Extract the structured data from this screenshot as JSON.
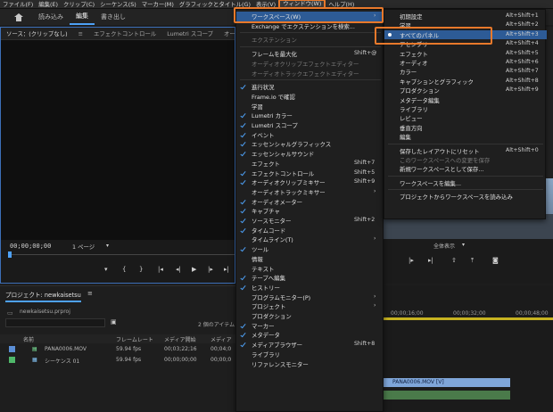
{
  "menubar": [
    "ファイル(F)",
    "編集(E)",
    "クリップ(C)",
    "シーケンス(S)",
    "マーカー(M)",
    "グラフィックとタイトル(G)",
    "表示(V)",
    "ウィンドウ(W)",
    "ヘルプ(H)"
  ],
  "workspace_tabs": [
    "読み込み",
    "編集",
    "書き出し"
  ],
  "source_tabs": [
    "ソース：(クリップなし)",
    "エフェクトコントロール",
    "Lumetri スコープ",
    "オーディ"
  ],
  "source_panel": {
    "timecode": "00;00;00;00",
    "page": "1 ページ"
  },
  "project": {
    "tab": "プロジェクト: newkaisetsu",
    "file": "newkaisetsu.prproj",
    "count": "2 個のアイテム",
    "headers": [
      "名前",
      "フレームレート",
      "メディア開始",
      "メディア"
    ],
    "rows": [
      {
        "name": "PANA0006.MOV",
        "fps": "59.94 fps",
        "start": "00;03;22;16",
        "end": "00;04;0"
      },
      {
        "name": "シーケンス 01",
        "fps": "59.94 fps",
        "start": "00;00;00;00",
        "end": "00;00;0"
      }
    ]
  },
  "right_panel": {
    "timecode": "00;00;00;00",
    "display": "全体表示",
    "ruler": [
      "00;00;16;00",
      "00;00;32;00",
      "00;00;48;00"
    ],
    "clip": "PANA0006.MOV [V]"
  },
  "window_menu": {
    "items": [
      {
        "label": "ワークスペース(W)",
        "submenu": true,
        "hl": true
      },
      {
        "label": "Exchange でエクステンションを検索..."
      },
      {
        "sep": true
      },
      {
        "label": "エクステンション",
        "dis": true
      },
      {
        "sep": true
      },
      {
        "label": "フレームを最大化",
        "sc": "Shift+@"
      },
      {
        "label": "オーディオクリップエフェクトエディター",
        "dis": true
      },
      {
        "label": "オーディオトラックエフェクトエディター",
        "dis": true
      },
      {
        "sep": true
      },
      {
        "label": "進行状況",
        "ck": true
      },
      {
        "label": "Frame.io で確認"
      },
      {
        "label": "学習"
      },
      {
        "label": "Lumetri カラー",
        "ck": true
      },
      {
        "label": "Lumetri スコープ",
        "ck": true
      },
      {
        "label": "イベント",
        "ck": true
      },
      {
        "label": "エッセンシャルグラフィックス",
        "ck": true
      },
      {
        "label": "エッセンシャルサウンド",
        "ck": true
      },
      {
        "label": "エフェクト",
        "sc": "Shift+7"
      },
      {
        "label": "エフェクトコントロール",
        "sc": "Shift+5",
        "ck": true
      },
      {
        "label": "オーディオクリップミキサー",
        "sc": "Shift+9",
        "ck": true
      },
      {
        "label": "オーディオトラックミキサー",
        "submenu": true
      },
      {
        "label": "オーディオメーター",
        "ck": true
      },
      {
        "label": "キャプチャ",
        "ck": true
      },
      {
        "label": "ソースモニター",
        "sc": "Shift+2",
        "ck": true
      },
      {
        "label": "タイムコード",
        "ck": true
      },
      {
        "label": "タイムライン(T)",
        "submenu": true
      },
      {
        "label": "ツール",
        "ck": true
      },
      {
        "label": "情報"
      },
      {
        "label": "テキスト"
      },
      {
        "label": "テープへ編集",
        "ck": true
      },
      {
        "label": "ヒストリー",
        "ck": true
      },
      {
        "label": "プログラムモニター(P)",
        "submenu": true
      },
      {
        "label": "プロジェクト",
        "submenu": true
      },
      {
        "label": "プロダクション"
      },
      {
        "label": "マーカー",
        "ck": true
      },
      {
        "label": "メタデータ",
        "ck": true
      },
      {
        "label": "メディアブラウザー",
        "sc": "Shift+8",
        "ck": true
      },
      {
        "label": "ライブラリ"
      },
      {
        "label": "リファレンスモニター"
      }
    ]
  },
  "workspace_menu": {
    "items": [
      {
        "label": "初期設定",
        "sc": "Alt+Shift+1"
      },
      {
        "label": "学習",
        "sc": "Alt+Shift+2"
      },
      {
        "label": "すべてのパネル",
        "sc": "Alt+Shift+3",
        "hl": true,
        "dot": true
      },
      {
        "label": "アセンブリ",
        "sc": "Alt+Shift+4"
      },
      {
        "label": "エフェクト",
        "sc": "Alt+Shift+5"
      },
      {
        "label": "オーディオ",
        "sc": "Alt+Shift+6"
      },
      {
        "label": "カラー",
        "sc": "Alt+Shift+7"
      },
      {
        "label": "キャプションとグラフィック",
        "sc": "Alt+Shift+8"
      },
      {
        "label": "プロダクション",
        "sc": "Alt+Shift+9"
      },
      {
        "label": "メタデータ編集"
      },
      {
        "label": "ライブラリ"
      },
      {
        "label": "レビュー"
      },
      {
        "label": "垂直方向"
      },
      {
        "label": "編集"
      },
      {
        "sep": true
      },
      {
        "label": "保存したレイアウトにリセット",
        "sc": "Alt+Shift+0"
      },
      {
        "label": "このワークスペースへの変更を保存",
        "dis": true
      },
      {
        "label": "新規ワークスペースとして保存..."
      },
      {
        "sep": true
      },
      {
        "label": "ワークスペースを編集..."
      },
      {
        "sep": true
      },
      {
        "label": "プロジェクトからワークスペースを読み込み"
      }
    ]
  }
}
